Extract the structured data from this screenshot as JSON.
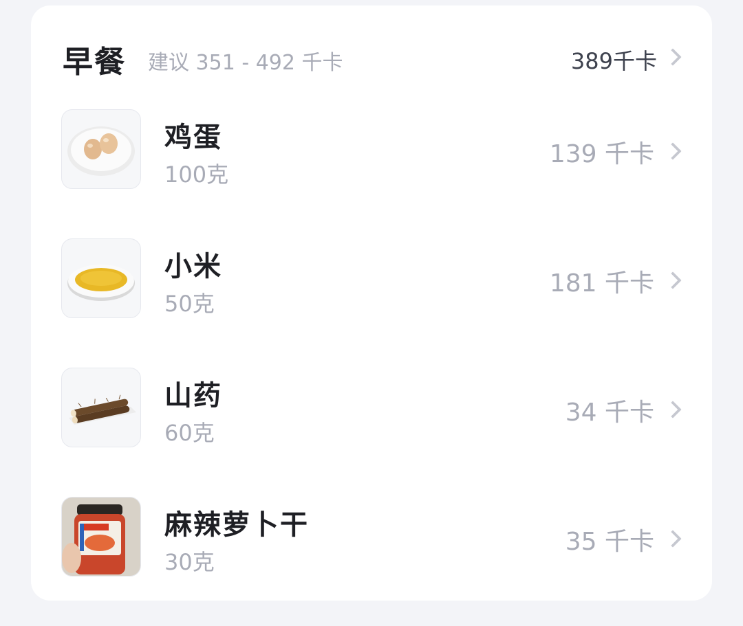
{
  "meal": {
    "title": "早餐",
    "suggestion": "建议 351 - 492 千卡",
    "total": "389千卡"
  },
  "items": [
    {
      "name": "鸡蛋",
      "amount": "100克",
      "kcal": "139 千卡",
      "icon": "eggs-plate-icon"
    },
    {
      "name": "小米",
      "amount": "50克",
      "kcal": "181 千卡",
      "icon": "millet-plate-icon"
    },
    {
      "name": "山药",
      "amount": "60克",
      "kcal": "34 千卡",
      "icon": "yam-icon"
    },
    {
      "name": "麻辣萝卜干",
      "amount": "30克",
      "kcal": "35 千卡",
      "icon": "spicy-radish-jar-icon"
    }
  ],
  "colors": {
    "background": "#f3f4f8",
    "card": "#ffffff",
    "primary_text": "#1e1f24",
    "secondary_text": "#a8abb6"
  }
}
